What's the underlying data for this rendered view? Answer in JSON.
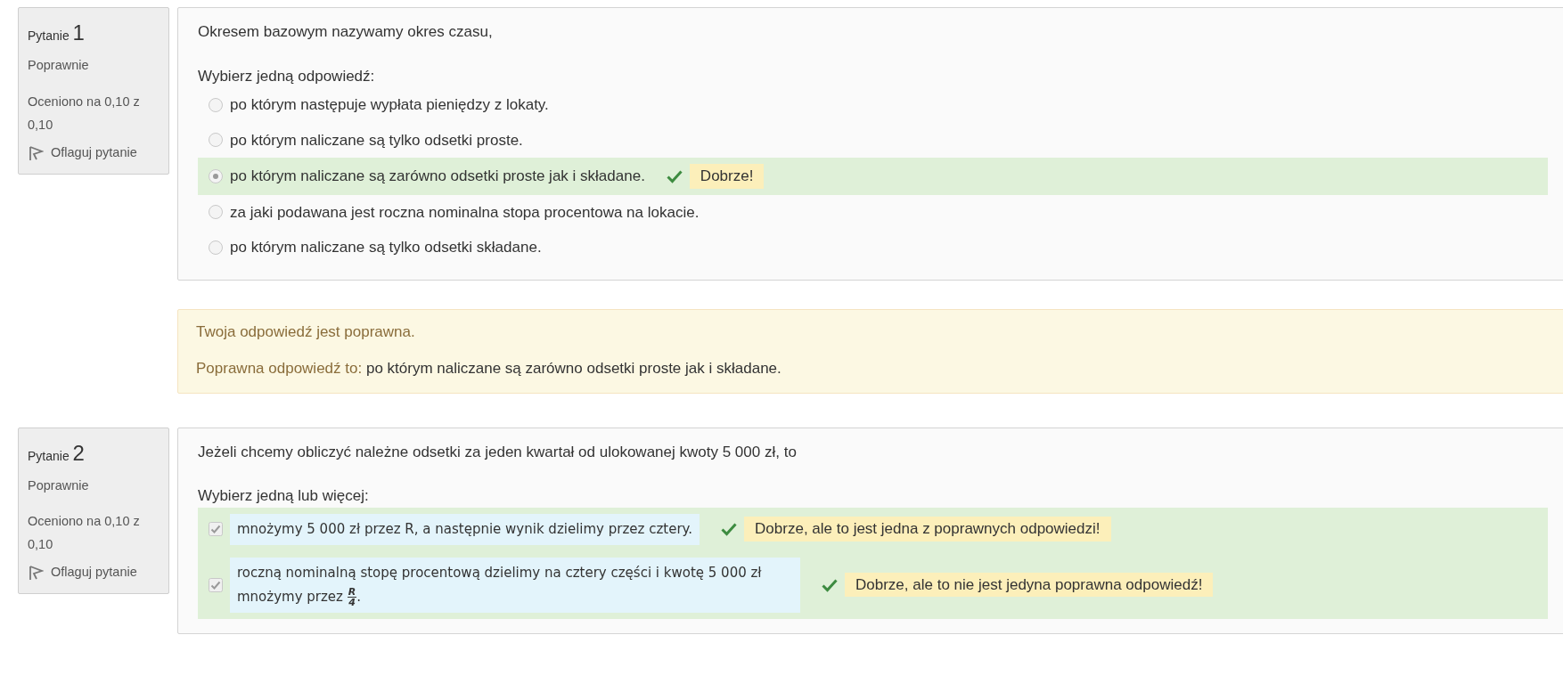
{
  "questions": [
    {
      "label": "Pytanie",
      "number": "1",
      "state": "Poprawnie",
      "grade": "Oceniono na 0,10 z 0,10",
      "flag": "Oflaguj pytanie",
      "text": "Okresem bazowym nazywamy okres czasu,",
      "prompt": "Wybierz jedną odpowiedź:",
      "kind": "radio",
      "answers": [
        {
          "text": "po którym następuje wypłata pieniędzy z lokaty.",
          "selected": false,
          "correct": false
        },
        {
          "text": "po którym naliczane są tylko odsetki proste.",
          "selected": false,
          "correct": false
        },
        {
          "text": "po którym naliczane są zarówno odsetki proste jak i składane.",
          "selected": true,
          "correct": true,
          "feedback": "Dobrze!"
        },
        {
          "text": "za jaki podawana jest roczna nominalna stopa procentowa na lokacie.",
          "selected": false,
          "correct": false
        },
        {
          "text": "po którym naliczane są tylko odsetki składane.",
          "selected": false,
          "correct": false
        }
      ],
      "outcome": {
        "status": "Twoja odpowiedź jest poprawna.",
        "right_label": "Poprawna odpowiedź to:",
        "right_answer": "po którym naliczane są zarówno odsetki proste jak i składane."
      }
    },
    {
      "label": "Pytanie",
      "number": "2",
      "state": "Poprawnie",
      "grade": "Oceniono na 0,10 z 0,10",
      "flag": "Oflaguj pytanie",
      "text": "Jeżeli chcemy obliczyć należne odsetki za jeden kwartał od ulokowanej kwoty 5 000  zł, to",
      "prompt": "Wybierz jedną lub więcej:",
      "kind": "checkbox",
      "answers": [
        {
          "text": "mnożymy 5 000  zł przez R, a następnie wynik dzielimy przez cztery.",
          "selected": true,
          "correct": true,
          "feedback": "Dobrze, ale to jest jedna z poprawnych odpowiedzi!"
        },
        {
          "text": "roczną nominalną stopę procentową dzielimy na cztery części i kwotę 5 000 zł mnożymy przez",
          "fraction": {
            "numerator": "R",
            "denominator": "4"
          },
          "suffix": ".",
          "selected": true,
          "correct": true,
          "feedback": "Dobrze, ale to nie jest jedyna poprawna odpowiedź!"
        }
      ]
    }
  ]
}
